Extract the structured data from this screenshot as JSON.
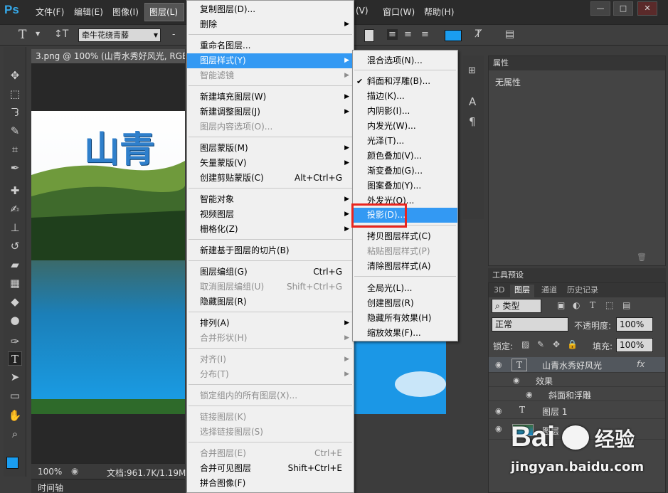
{
  "app": {
    "logo": "Ps"
  },
  "menubar": {
    "items": [
      "文件(F)",
      "编辑(E)",
      "图像(I)",
      "图层(L)",
      "(V)",
      "窗口(W)",
      "帮助(H)"
    ],
    "window_buttons": [
      "—",
      "□",
      "✕"
    ]
  },
  "options": {
    "font_family": "牵牛花绕青藤",
    "font_style": "-"
  },
  "document": {
    "tab_title": "3.png @ 100% (山青水秀好风光, RGB/"
  },
  "canvas": {
    "headline": "山青"
  },
  "status": {
    "zoom": "100%",
    "doc_info": "文档:961.7K/1.19M"
  },
  "timeline": {
    "label": "时间轴"
  },
  "properties": {
    "title": "属性",
    "empty_text": "无属性"
  },
  "tool_presets": {
    "title": "工具预设"
  },
  "layers": {
    "tabs": [
      "3D",
      "图层",
      "通道",
      "历史记录"
    ],
    "filter_kind": "类型",
    "blend_mode": "正常",
    "opacity_label": "不透明度:",
    "opacity": "100%",
    "lock_label": "锁定:",
    "fill_label": "填充:",
    "fill": "100%",
    "rows": [
      {
        "name": "山青水秀好风光",
        "badge": "fx"
      },
      {
        "name": "效果"
      },
      {
        "name": "斜面和浮雕"
      },
      {
        "name": "图层 1"
      },
      {
        "name": "图层"
      }
    ]
  },
  "layer_menu": {
    "items": [
      {
        "label": "复制图层(D)...",
        "enabled": true
      },
      {
        "label": "删除",
        "enabled": true,
        "submenu": true
      },
      {
        "label": "重命名图层...",
        "enabled": true
      },
      {
        "label": "图层样式(Y)",
        "enabled": true,
        "submenu": true,
        "highlighted": true
      },
      {
        "label": "智能滤镜",
        "enabled": false,
        "submenu": true
      },
      {
        "label": "新建填充图层(W)",
        "enabled": true,
        "submenu": true
      },
      {
        "label": "新建调整图层(J)",
        "enabled": true,
        "submenu": true
      },
      {
        "label": "图层内容选项(O)...",
        "enabled": false
      },
      {
        "label": "图层蒙版(M)",
        "enabled": true,
        "submenu": true
      },
      {
        "label": "矢量蒙版(V)",
        "enabled": true,
        "submenu": true
      },
      {
        "label": "创建剪贴蒙版(C)",
        "enabled": true,
        "shortcut": "Alt+Ctrl+G"
      },
      {
        "label": "智能对象",
        "enabled": true,
        "submenu": true
      },
      {
        "label": "视频图层",
        "enabled": true,
        "submenu": true
      },
      {
        "label": "栅格化(Z)",
        "enabled": true,
        "submenu": true
      },
      {
        "label": "新建基于图层的切片(B)",
        "enabled": true
      },
      {
        "label": "图层编组(G)",
        "enabled": true,
        "shortcut": "Ctrl+G"
      },
      {
        "label": "取消图层编组(U)",
        "enabled": false,
        "shortcut": "Shift+Ctrl+G"
      },
      {
        "label": "隐藏图层(R)",
        "enabled": true
      },
      {
        "label": "排列(A)",
        "enabled": true,
        "submenu": true
      },
      {
        "label": "合并形状(H)",
        "enabled": false,
        "submenu": true
      },
      {
        "label": "对齐(I)",
        "enabled": false,
        "submenu": true
      },
      {
        "label": "分布(T)",
        "enabled": false,
        "submenu": true
      },
      {
        "label": "锁定组内的所有图层(X)...",
        "enabled": false
      },
      {
        "label": "链接图层(K)",
        "enabled": false
      },
      {
        "label": "选择链接图层(S)",
        "enabled": false
      },
      {
        "label": "合并图层(E)",
        "enabled": false,
        "shortcut": "Ctrl+E"
      },
      {
        "label": "合并可见图层",
        "enabled": true,
        "shortcut": "Shift+Ctrl+E"
      },
      {
        "label": "拼合图像(F)",
        "enabled": true
      }
    ]
  },
  "style_menu": {
    "items": [
      {
        "label": "混合选项(N)...",
        "enabled": true
      },
      {
        "label": "斜面和浮雕(B)...",
        "enabled": true,
        "checked": true
      },
      {
        "label": "描边(K)...",
        "enabled": true
      },
      {
        "label": "内阴影(I)...",
        "enabled": true
      },
      {
        "label": "内发光(W)...",
        "enabled": true
      },
      {
        "label": "光泽(T)...",
        "enabled": true
      },
      {
        "label": "颜色叠加(V)...",
        "enabled": true
      },
      {
        "label": "渐变叠加(G)...",
        "enabled": true
      },
      {
        "label": "图案叠加(Y)...",
        "enabled": true
      },
      {
        "label": "外发光(O)...",
        "enabled": true
      },
      {
        "label": "投影(D)...",
        "enabled": true,
        "highlighted": true
      },
      {
        "label": "拷贝图层样式(C)",
        "enabled": true
      },
      {
        "label": "粘贴图层样式(P)",
        "enabled": false
      },
      {
        "label": "清除图层样式(A)",
        "enabled": true
      },
      {
        "label": "全局光(L)...",
        "enabled": true
      },
      {
        "label": "创建图层(R)",
        "enabled": true
      },
      {
        "label": "隐藏所有效果(H)",
        "enabled": true
      },
      {
        "label": "缩放效果(F)...",
        "enabled": true
      }
    ]
  },
  "watermark": {
    "brand": "Bai",
    "brand2": "经验",
    "url": "jingyan.baidu.com"
  },
  "colors": {
    "highlight": "#3399f3",
    "annotation_red": "#e8251f",
    "foreground": "#1a9df0",
    "ps_blue": "#36a8e8"
  }
}
